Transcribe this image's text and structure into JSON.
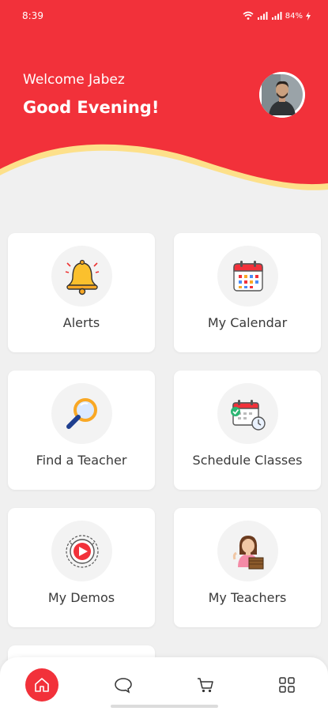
{
  "status_bar": {
    "time": "8:39",
    "battery": "84%"
  },
  "header": {
    "welcome": "Welcome Jabez",
    "greeting": "Good Evening!"
  },
  "cards": [
    {
      "label": "Alerts",
      "icon": "bell-icon"
    },
    {
      "label": "My Calendar",
      "icon": "calendar-icon"
    },
    {
      "label": "Find a Teacher",
      "icon": "magnifier-icon"
    },
    {
      "label": "Schedule Classes",
      "icon": "schedule-icon"
    },
    {
      "label": "My Demos",
      "icon": "video-icon"
    },
    {
      "label": "My Teachers",
      "icon": "teacher-icon"
    }
  ],
  "bottom_nav": [
    "home-icon",
    "chat-icon",
    "cart-icon",
    "grid-icon"
  ],
  "colors": {
    "primary": "#f2313a",
    "accent_wave": "#fde08a",
    "background": "#f0f0f0"
  }
}
